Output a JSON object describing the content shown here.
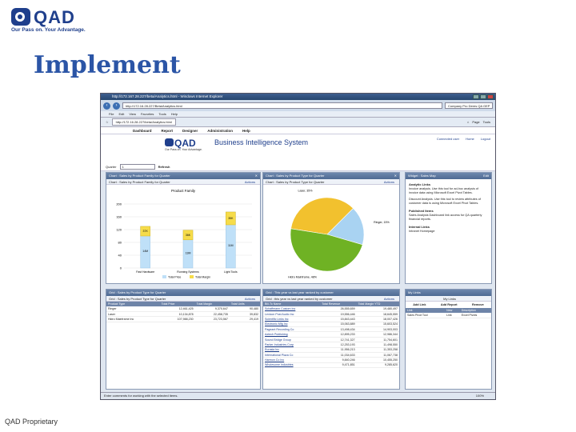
{
  "logo": {
    "text": "QAD",
    "tagline": "Our Pass on. Your Advantage."
  },
  "slide_title": "Implement",
  "footer": "QAD Proprietary",
  "browser": {
    "title": "http://172.167.28.227/beta/Analytics.html - Windows Internet Explorer",
    "address": "http://172.16.28.227/Beta/Analytics.html",
    "search": "Company Pro Deres QA GEP",
    "menu": [
      "File",
      "Edit",
      "View",
      "Favorites",
      "Tools",
      "Help"
    ],
    "tab_label": "http://172.16.28.227/beta/Analytics.html",
    "tools": [
      "Page",
      "Tools"
    ],
    "status": "Enter comments for working with the selected items.",
    "zoom": "100%"
  },
  "app": {
    "menu": [
      "Dashboard",
      "Report",
      "Designer",
      "Administration",
      "Help"
    ],
    "logo": "QAD",
    "title": "Business Intelligence System",
    "tagline": "Our Pass on. Your Advantage.",
    "user_links": [
      "Connected user",
      "Home",
      "Logout"
    ],
    "filter_label": "Quarter",
    "filter_value": "1",
    "refresh": "Refresh"
  },
  "pane1": {
    "header": "Chart : Sales by Product Family for Quarter",
    "sub": "Chart : Sales by Product Family for Quarter",
    "action": "Actions",
    "chart_title": "Product Family"
  },
  "pane2": {
    "header": "Chart : Sales by Product Type for Quarter",
    "sub": "Chart : Sales by Product Type for Quarter",
    "action": "Actions"
  },
  "pane3": {
    "header": "Widget : Sales Map",
    "edit": "Edit",
    "sections": [
      {
        "title": "Analytic Links",
        "text": "Invoice analysis. Use this tool for ad-hoc analysis of invoice data using Microsoft Excel Pivot Tables."
      },
      {
        "title": "",
        "text": "Discount Analysis. Use this tool to review attributes of customer data is using Microsoft Excel Pivot Tables."
      },
      {
        "title": "Published Items",
        "text": "Sales Analysis Dashboard link access for QA quarterly financial reports."
      },
      {
        "title": "Internal Links",
        "text": "Intranet Homepage"
      }
    ]
  },
  "pane4": {
    "header": "Grid : Sales by Product Type for Quarter",
    "sub": "Grid : Sales by Product Type for Quarter",
    "action": "Actions",
    "columns": [
      "Product Type",
      "Total Price",
      "Total Margin",
      "Total Units"
    ],
    "rows": [
      [
        "Ringer",
        "12,461,425",
        "9,370,647",
        "90,480"
      ],
      [
        "Laser",
        "10,134,878",
        "22,458,735",
        "39,832"
      ],
      [
        "Hidro Mainframe Inc",
        "107,988,230",
        "23,723,567",
        "29,419"
      ]
    ]
  },
  "pane5": {
    "header": "Grid : This year vs last year ranked by customer",
    "sub": "Grid : this year vs last year ranked by customer",
    "action": "Actions",
    "columns": [
      "Bill-To Name",
      "Total Revenue",
      "Total Margin YTD"
    ],
    "rows": [
      [
        "Schaffmann Custom Inc",
        "26,555,659",
        "19,480,497"
      ],
      [
        "Lexicon Post Audio Inc",
        "19,556,446",
        "18,645,559"
      ],
      [
        "Scientific Links Inc",
        "15,843,443",
        "18,007,426"
      ],
      [
        "Electronic Mfg Inc",
        "15,063,889",
        "15,603,524"
      ],
      [
        "Pageant Recording Co",
        "13,498,434",
        "14,903,003"
      ],
      [
        "Aztech Publishing",
        "12,895,233",
        "12,986,344"
      ],
      [
        "Sound Bridge Group",
        "12,741,327",
        "11,754,601"
      ],
      [
        "Parker Industries Corp",
        "12,253,193",
        "11,498,550"
      ],
      [
        "Eurasia Inc",
        "11,956,213",
        "11,353,258"
      ],
      [
        "International Plaza Co",
        "11,034,633",
        "11,067,738"
      ],
      [
        "Harmon Co Inc",
        "9,840,246",
        "10,455,250"
      ],
      [
        "Wholesome Industries",
        "9,471,851",
        "9,285,620"
      ]
    ]
  },
  "pane6": {
    "header": "My Links",
    "sub": "My Links",
    "columns": [
      "Link",
      "New",
      "Description"
    ],
    "actions": [
      "Add Link",
      "Add Report",
      "Remove"
    ],
    "rows": [
      [
        "Sales Pivot Tool",
        "Link",
        "Excel Pivots"
      ]
    ]
  },
  "chart_data": [
    {
      "type": "bar",
      "title": "Product Family",
      "categories": [
        "Fast Hardware",
        "Running Systems",
        "Light Tools"
      ],
      "series": [
        {
          "name": "Total Price",
          "values": [
            130,
            118,
            175
          ]
        },
        {
          "name": "Total Margin",
          "values": [
            30,
            30,
            40
          ]
        }
      ],
      "ylim": [
        0,
        200
      ],
      "ytick_labels": [
        "0",
        "40",
        "80",
        "120",
        "160",
        "200"
      ],
      "data_labels": [
        [
          "37K",
          "36K",
          "35K"
        ],
        [
          "14M",
          "13M",
          "11M"
        ]
      ],
      "legend": "bottom"
    },
    {
      "type": "pie",
      "title": "Sales by Product Type",
      "categories": [
        "Laser",
        "Ringer",
        "Hidro Mainframe"
      ],
      "values": [
        35,
        17,
        48
      ],
      "labels": [
        "Laser, 35%",
        "Ringer, 15%",
        "Hidro Mainframe, 48%"
      ],
      "colors": [
        "#f2c12e",
        "#a9d3f2",
        "#6fb224"
      ]
    }
  ]
}
